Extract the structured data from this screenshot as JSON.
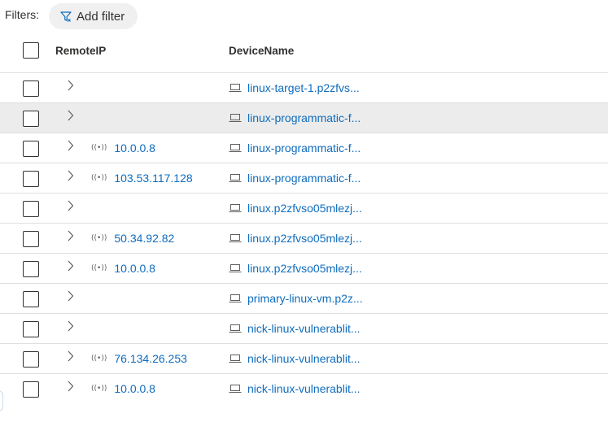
{
  "filters": {
    "label": "Filters:",
    "add_filter": "Add filter"
  },
  "columns": {
    "remote_ip": "RemoteIP",
    "device_name": "DeviceName"
  },
  "rows": [
    {
      "remote_ip": "",
      "device": "linux-target-1.p2zfvs...",
      "selected": false
    },
    {
      "remote_ip": "",
      "device": "linux-programmatic-f...",
      "selected": true
    },
    {
      "remote_ip": "10.0.0.8",
      "device": "linux-programmatic-f...",
      "selected": false
    },
    {
      "remote_ip": "103.53.117.128",
      "device": "linux-programmatic-f...",
      "selected": false
    },
    {
      "remote_ip": "",
      "device": "linux.p2zfvso05mlezj...",
      "selected": false
    },
    {
      "remote_ip": "50.34.92.82",
      "device": "linux.p2zfvso05mlezj...",
      "selected": false
    },
    {
      "remote_ip": "10.0.0.8",
      "device": "linux.p2zfvso05mlezj...",
      "selected": false
    },
    {
      "remote_ip": "",
      "device": "primary-linux-vm.p2z...",
      "selected": false
    },
    {
      "remote_ip": "",
      "device": "nick-linux-vulnerablit...",
      "selected": false
    },
    {
      "remote_ip": "76.134.26.253",
      "device": "nick-linux-vulnerablit...",
      "selected": false
    },
    {
      "remote_ip": "10.0.0.8",
      "device": "nick-linux-vulnerablit...",
      "selected": false
    }
  ],
  "colors": {
    "link": "#0f6cbd",
    "text": "#323130",
    "selected_row": "#ececec",
    "divider": "#e1dfdd"
  },
  "icons": {
    "filter": "filter-icon",
    "expand": "chevron-right-icon",
    "ip": "signal-icon",
    "device": "laptop-icon"
  }
}
